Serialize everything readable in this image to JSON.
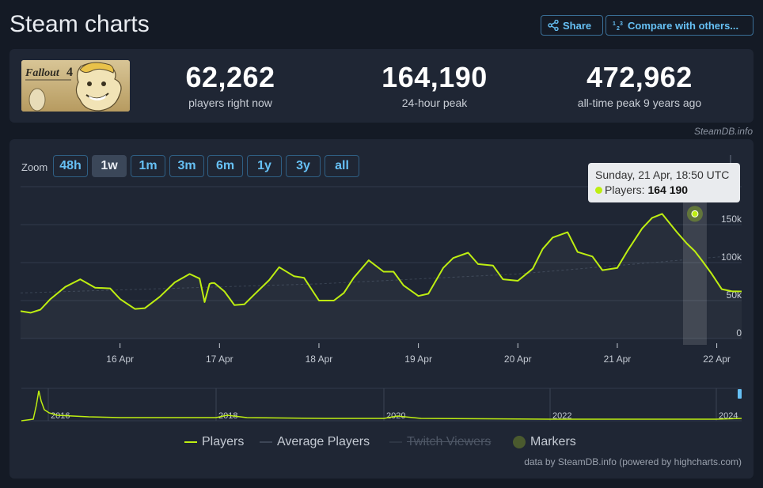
{
  "page": {
    "title": "Steam charts",
    "share_label": "Share",
    "compare_label": "Compare with others..."
  },
  "game": {
    "image_icon": "fallout-4-vault-boy-icon",
    "logo_text": "Fallout 4"
  },
  "stats": [
    {
      "value": "62,262",
      "label": "players right now"
    },
    {
      "value": "164,190",
      "label": "24-hour peak"
    },
    {
      "value": "472,962",
      "label": "all-time peak 9 years ago"
    }
  ],
  "credit_top": "SteamDB.info",
  "zoom": {
    "label": "Zoom",
    "options": [
      "48h",
      "1w",
      "1m",
      "3m",
      "6m",
      "1y",
      "3y",
      "all"
    ],
    "selected": "1w"
  },
  "tooltip": {
    "date": "Sunday, 21 Apr, 18:50 UTC",
    "series": "Players:",
    "value": "164 190"
  },
  "legend": {
    "players": "Players",
    "average_players": "Average Players",
    "twitch_viewers": "Twitch Viewers",
    "markers": "Markers"
  },
  "credit_bottom": "data by SteamDB.info (powered by highcharts.com)",
  "colors": {
    "players": "#beee11",
    "accent": "#66c0f4",
    "panel": "#1f2634",
    "background": "#141a25"
  },
  "chart_data": {
    "type": "line",
    "x_ticks": [
      "16 Apr",
      "17 Apr",
      "18 Apr",
      "19 Apr",
      "20 Apr",
      "21 Apr",
      "22 Apr"
    ],
    "y_ticks": [
      "0",
      "50k",
      "100k",
      "150k"
    ],
    "ylim": [
      0,
      200000
    ],
    "highlight": {
      "x": "21 Apr 18:50",
      "y": 164190
    },
    "series": [
      {
        "name": "Players",
        "x_days": [
          15.0,
          15.1,
          15.2,
          15.3,
          15.45,
          15.6,
          15.75,
          15.9,
          16.0,
          16.15,
          16.25,
          16.4,
          16.55,
          16.7,
          16.8,
          16.85,
          16.9,
          16.92,
          16.95,
          17.05,
          17.15,
          17.25,
          17.35,
          17.5,
          17.6,
          17.75,
          17.85,
          18.0,
          18.15,
          18.25,
          18.35,
          18.5,
          18.65,
          18.75,
          18.85,
          19.0,
          19.1,
          19.25,
          19.35,
          19.5,
          19.6,
          19.75,
          19.85,
          20.0,
          20.15,
          20.25,
          20.35,
          20.5,
          20.6,
          20.75,
          20.85,
          21.0,
          21.1,
          21.25,
          21.35,
          21.45,
          21.6,
          21.7,
          21.78,
          21.85,
          21.95,
          22.05,
          22.15,
          22.25
        ],
        "values": [
          36000,
          34000,
          38000,
          52000,
          68000,
          78000,
          67000,
          66000,
          52000,
          39000,
          40000,
          55000,
          74000,
          85000,
          79000,
          48000,
          72000,
          73000,
          73000,
          62000,
          44000,
          45000,
          58000,
          77000,
          94000,
          82000,
          80000,
          50000,
          50000,
          60000,
          80000,
          103000,
          88000,
          88000,
          70000,
          56000,
          59000,
          93000,
          106000,
          113000,
          98000,
          96000,
          78000,
          76000,
          92000,
          118000,
          133000,
          140000,
          114000,
          108000,
          90000,
          93000,
          115000,
          145000,
          159000,
          164190,
          140000,
          125000,
          115000,
          103000,
          85000,
          65000,
          62262,
          62000
        ],
        "color": "#beee11"
      }
    ],
    "navigator": {
      "x_ticks": [
        "2016",
        "2018",
        "2020",
        "2022",
        "2024"
      ],
      "note": "overview of all time, peak near launch"
    }
  }
}
